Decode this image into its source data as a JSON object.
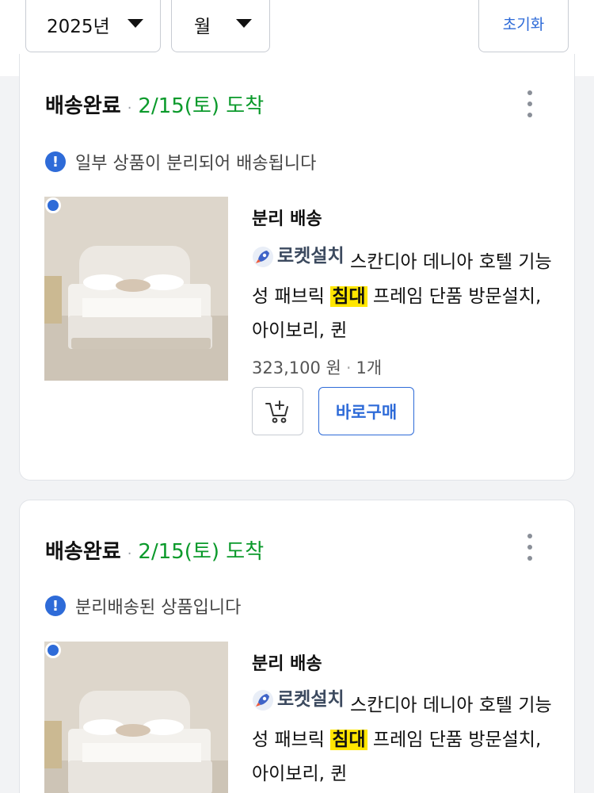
{
  "filters": {
    "year": "2025년",
    "month": "월",
    "reset_label": "초기화"
  },
  "orders": [
    {
      "status": "배송완료",
      "arrival": "2/15(토) 도착",
      "notice": "일부 상품이 분리되어 배송됩니다",
      "shipping_type": "분리 배송",
      "badge": "로켓설치",
      "name_before": "스칸디아 데니아 호텔 기능성 패브릭",
      "name_highlight": "침대",
      "name_after": "프레임 단품 방문설치, 아이보리, 퀸",
      "price": "323,100 원",
      "quantity": "1개",
      "buy_label": "바로구매"
    },
    {
      "status": "배송완료",
      "arrival": "2/15(토) 도착",
      "notice": "분리배송된 상품입니다",
      "shipping_type": "분리 배송",
      "badge": "로켓설치",
      "name_before": "스칸디아 데니아 호텔 기능성 패브릭",
      "name_highlight": "침대",
      "name_after": "프레임 단품 방문설치, 아이보리, 퀸"
    }
  ],
  "colors": {
    "accent": "#2e6bd8",
    "arrival_green": "#0b9a2b",
    "highlight": "#ffe600"
  },
  "icons": {
    "dropdown": "caret-down-icon",
    "more": "kebab-icon",
    "notice": "info-icon",
    "badge": "rocket-icon",
    "cart": "add-to-cart-icon"
  }
}
